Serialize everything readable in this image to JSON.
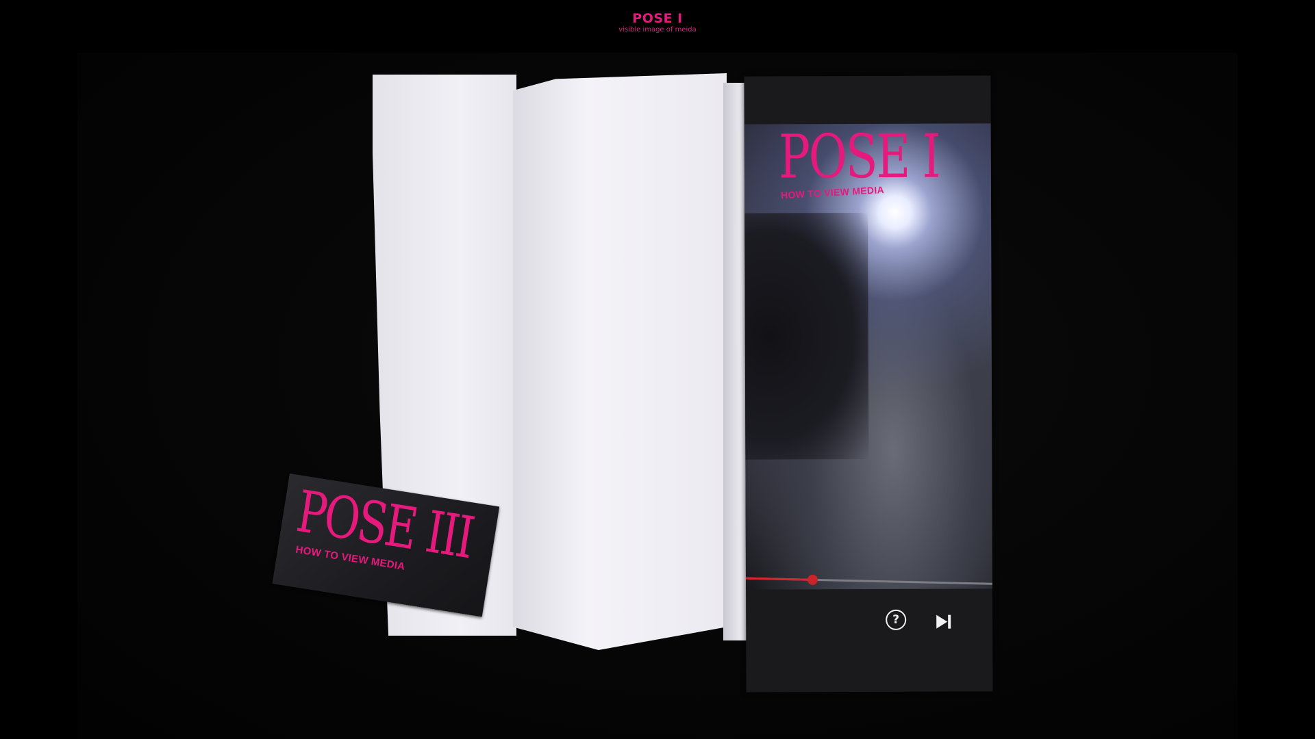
{
  "header": {
    "title": "POSE I",
    "subtitle": "visible image of meida"
  },
  "flyer": {
    "title": "POSE I",
    "subtitle": "HOW TO VIEW MEDIA",
    "progress": 0.27,
    "help_icon": "help-circle-icon",
    "next_icon": "skip-next-icon"
  },
  "card": {
    "title": "POSE III",
    "subtitle": "HOW TO VIEW MEDIA"
  },
  "colors": {
    "accent": "#e6197d",
    "background": "#000000",
    "progress": "#d8262c"
  }
}
